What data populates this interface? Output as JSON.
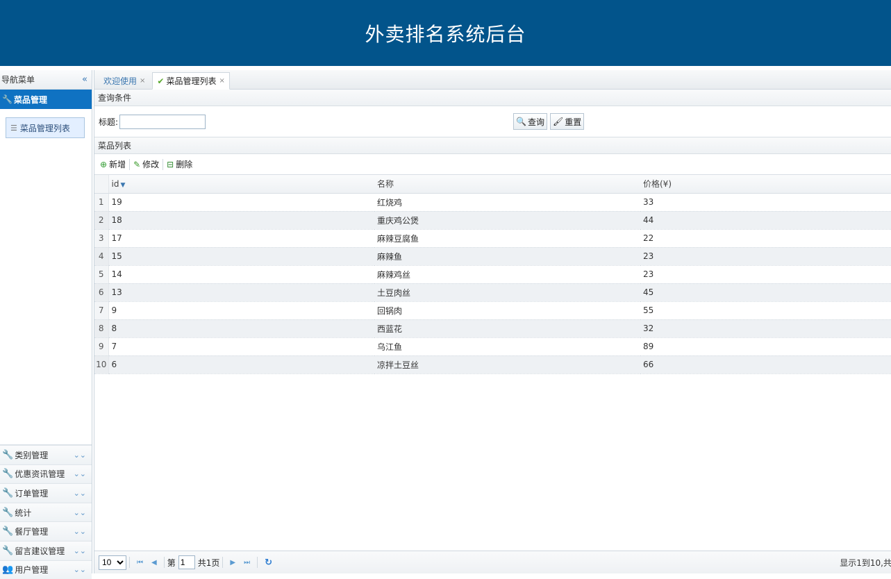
{
  "header": {
    "title": "外卖排名系统后台"
  },
  "nav": {
    "title": "导航菜单",
    "collapse_glyph": "«",
    "active_section": "菜品管理",
    "active_items": [
      "菜品管理列表"
    ],
    "sections": [
      {
        "label": "类别管理",
        "icon": "wrench-icon"
      },
      {
        "label": "优惠资讯管理",
        "icon": "wrench-icon"
      },
      {
        "label": "订单管理",
        "icon": "wrench-icon"
      },
      {
        "label": "统计",
        "icon": "wrench-icon"
      },
      {
        "label": "餐厅管理",
        "icon": "wrench-icon"
      },
      {
        "label": "留言建议管理",
        "icon": "wrench-icon"
      },
      {
        "label": "用户管理",
        "icon": "users-icon"
      }
    ]
  },
  "tabs": [
    {
      "label": "欢迎使用",
      "close": "×"
    },
    {
      "label": "菜品管理列表",
      "close": "×",
      "active": true
    }
  ],
  "query": {
    "panel_title": "查询条件",
    "title_label": "标题:",
    "title_value": "",
    "search_label": "查询",
    "reset_label": "重置"
  },
  "list": {
    "panel_title": "菜品列表",
    "toolbar": {
      "add": "新增",
      "edit": "修改",
      "delete": "删除"
    },
    "columns": [
      "id",
      "名称",
      "价格(¥)"
    ],
    "rows": [
      {
        "n": "1",
        "id": "19",
        "name": "红烧鸡",
        "price": "33"
      },
      {
        "n": "2",
        "id": "18",
        "name": "重庆鸡公煲",
        "price": "44"
      },
      {
        "n": "3",
        "id": "17",
        "name": "麻辣豆腐鱼",
        "price": "22"
      },
      {
        "n": "4",
        "id": "15",
        "name": "麻辣鱼",
        "price": "23"
      },
      {
        "n": "5",
        "id": "14",
        "name": "麻辣鸡丝",
        "price": "23"
      },
      {
        "n": "6",
        "id": "13",
        "name": "土豆肉丝",
        "price": "45"
      },
      {
        "n": "7",
        "id": "9",
        "name": "回锅肉",
        "price": "55"
      },
      {
        "n": "8",
        "id": "8",
        "name": "西蓝花",
        "price": "32"
      },
      {
        "n": "9",
        "id": "7",
        "name": "乌江鱼",
        "price": "89"
      },
      {
        "n": "10",
        "id": "6",
        "name": "凉拌土豆丝",
        "price": "66"
      }
    ]
  },
  "pager": {
    "page_size": "10",
    "page_prefix": "第",
    "page_value": "1",
    "page_total": "共1页",
    "info": "显示1到10,共"
  },
  "colors": {
    "header_bg": "#02548b",
    "active_nav": "#0f72c2"
  }
}
